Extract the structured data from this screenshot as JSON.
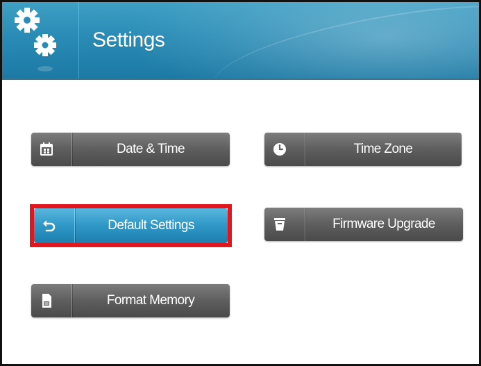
{
  "header": {
    "title": "Settings",
    "icon": "gears-icon"
  },
  "buttons": {
    "date_time": {
      "label": "Date & Time",
      "icon": "calendar-icon"
    },
    "time_zone": {
      "label": "Time Zone",
      "icon": "clock-icon"
    },
    "default_settings": {
      "label": "Default Settings",
      "icon": "undo-icon",
      "selected": true
    },
    "firmware_upgrade": {
      "label": "Firmware Upgrade",
      "icon": "firmware-icon"
    },
    "format_memory": {
      "label": "Format Memory",
      "icon": "sd-card-icon"
    }
  },
  "colors": {
    "header": "#2a8cb6",
    "button": "#5f5f5f",
    "button_active": "#2f97c6",
    "highlight": "#e2161c"
  }
}
